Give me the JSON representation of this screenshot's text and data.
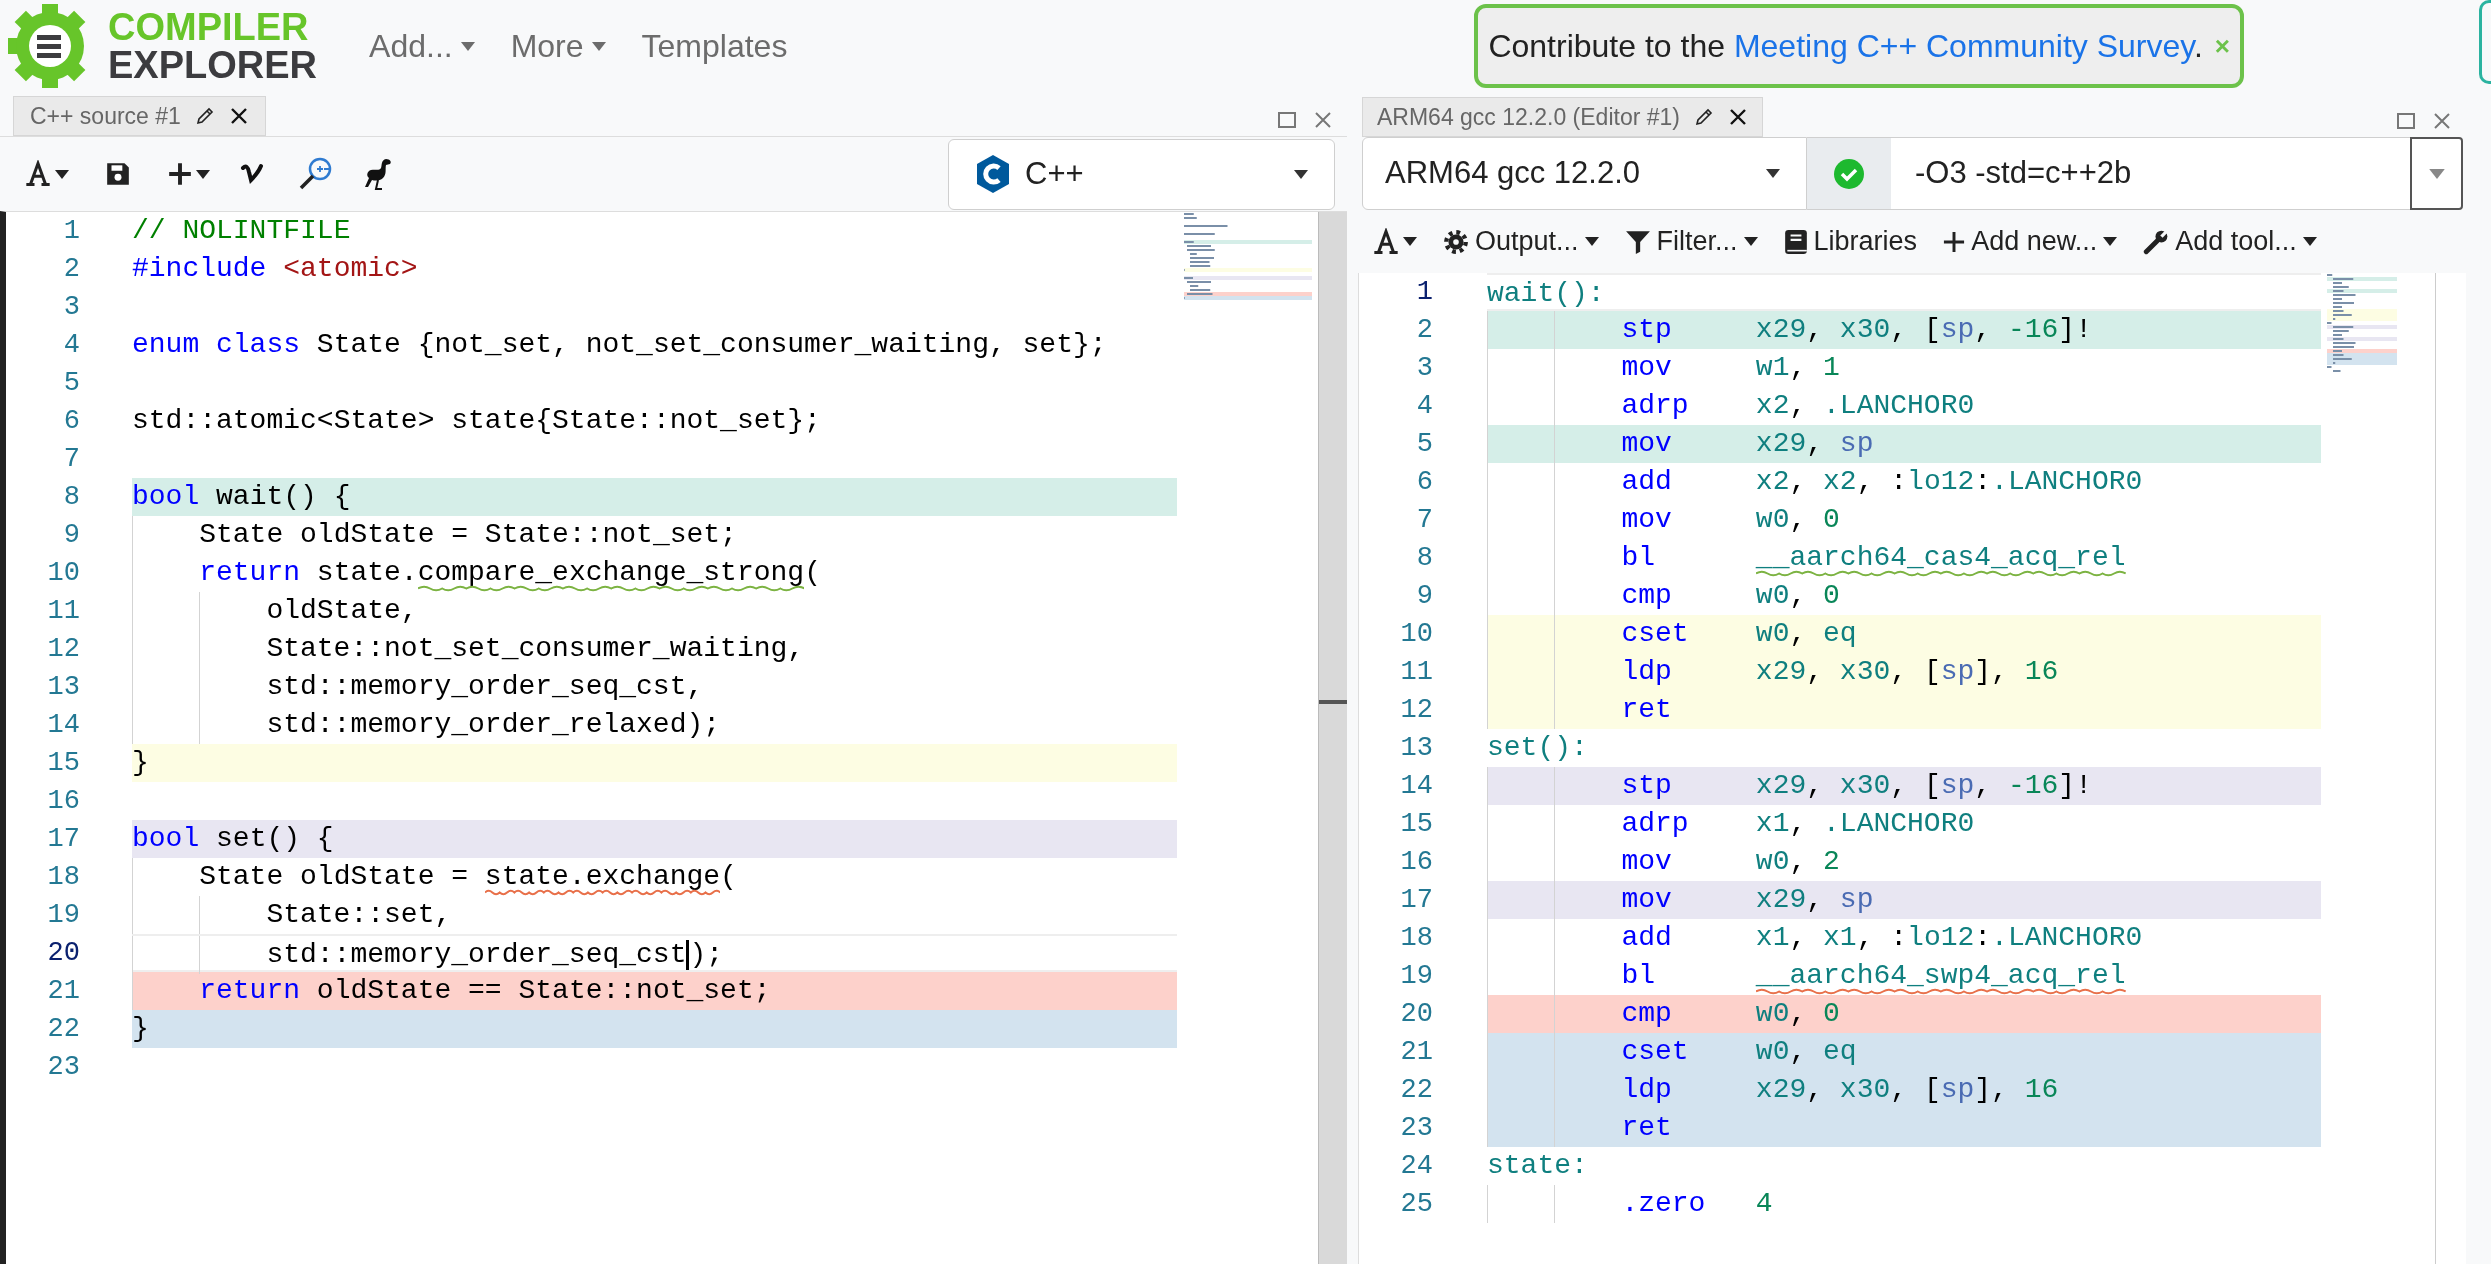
{
  "header": {
    "logo": {
      "line_1": "COMPILER",
      "line_2": "EXPLORER"
    },
    "menu": [
      {
        "label": "Add...",
        "dropdown": true
      },
      {
        "label": "More",
        "dropdown": true
      },
      {
        "label": "Templates",
        "dropdown": false
      }
    ],
    "banner": {
      "text": "Contribute to the",
      "link": "Meeting C++ Community Survey",
      "text_after": ".",
      "close": "×"
    }
  },
  "source_pane": {
    "tab": {
      "title": "C++ source #1"
    },
    "language": "C++",
    "lines": [
      {
        "number": "1",
        "current": false,
        "tokens": [
          {
            "kind": "comment",
            "text": "// NOLINTFILE"
          }
        ]
      },
      {
        "number": "2",
        "current": false,
        "tokens": [
          {
            "kind": "keyword",
            "text": "#include"
          },
          {
            "kind": "string",
            "text": " <atomic>"
          }
        ]
      },
      {
        "number": "3",
        "current": false
      },
      {
        "number": "4",
        "current": false,
        "tokens": [
          {
            "kind": "keyword",
            "text": "enum class"
          },
          {
            "kind": "plain",
            "text": " State {not_set, not_set_consumer_waiting, set};"
          }
        ]
      },
      {
        "number": "5",
        "current": false
      },
      {
        "number": "6",
        "current": false,
        "tokens": [
          {
            "kind": "plain",
            "text": "std::atomic<State> state{State::not_set};"
          }
        ]
      },
      {
        "number": "7",
        "current": false
      },
      {
        "number": "8",
        "current": false,
        "color": "#d5eee8",
        "tokens": [
          {
            "kind": "keyword",
            "text": "bool"
          },
          {
            "kind": "plain",
            "text": " wait() {"
          }
        ]
      },
      {
        "number": "9",
        "current": false,
        "tokens": [
          {
            "kind": "plain",
            "text": "    State oldState = State::not_set;"
          }
        ]
      },
      {
        "number": "10",
        "current": false,
        "tokens": [
          {
            "kind": "keyword",
            "text": "    return"
          },
          {
            "kind": "plain",
            "text": " state."
          },
          {
            "kind": "plain",
            "text": "compare_exchange_strong",
            "color": "#7cb342"
          },
          {
            "kind": "plain",
            "text": "("
          }
        ]
      },
      {
        "number": "11",
        "current": false,
        "tokens": [
          {
            "kind": "plain",
            "text": "        oldState,"
          }
        ]
      },
      {
        "number": "12",
        "current": false,
        "tokens": [
          {
            "kind": "plain",
            "text": "        State::not_set_consumer_waiting,"
          }
        ]
      },
      {
        "number": "13",
        "current": false,
        "tokens": [
          {
            "kind": "plain",
            "text": "        std::memory_order_seq_cst,"
          }
        ]
      },
      {
        "number": "14",
        "current": false,
        "tokens": [
          {
            "kind": "plain",
            "text": "        std::memory_order_relaxed);"
          }
        ]
      },
      {
        "number": "15",
        "current": false,
        "color": "#fdfde3",
        "tokens": [
          {
            "kind": "plain",
            "text": "}"
          }
        ]
      },
      {
        "number": "16",
        "current": false
      },
      {
        "number": "17",
        "current": false,
        "color": "#e8e6f2",
        "tokens": [
          {
            "kind": "keyword",
            "text": "bool"
          },
          {
            "kind": "plain",
            "text": " set() {"
          }
        ]
      },
      {
        "number": "18",
        "current": false,
        "tokens": [
          {
            "kind": "plain",
            "text": "    State oldState = "
          },
          {
            "kind": "plain",
            "text": "state.exchange",
            "color": "#e8704a"
          },
          {
            "kind": "plain",
            "text": "("
          }
        ]
      },
      {
        "number": "19",
        "current": false,
        "tokens": [
          {
            "kind": "plain",
            "text": "        State::set,"
          }
        ]
      },
      {
        "number": "20",
        "current": true,
        "tokens": [
          {
            "kind": "plain",
            "text": "        std::memory_order_seq_cst",
            "caret": true
          },
          {
            "kind": "plain",
            "text": ");"
          }
        ]
      },
      {
        "number": "21",
        "current": false,
        "color": "#fdd1cb",
        "tokens": [
          {
            "kind": "keyword",
            "text": "    return"
          },
          {
            "kind": "plain",
            "text": " oldState == State::not_set;"
          }
        ]
      },
      {
        "number": "22",
        "current": false,
        "color": "#d3e3ef",
        "tokens": [
          {
            "kind": "plain",
            "text": "}"
          }
        ]
      },
      {
        "number": "23",
        "current": false
      }
    ]
  },
  "compiler_pane": {
    "tab": {
      "title": "ARM64 gcc 12.2.0 (Editor #1)"
    },
    "compiler": "ARM64 gcc 12.2.0",
    "compile_ok": true,
    "options": "-O3 -std=c++2b",
    "toolbar": [
      {
        "label": "Output...",
        "dropdown": true
      },
      {
        "label": "Filter...",
        "dropdown": true
      },
      {
        "label": "Libraries",
        "dropdown": false
      },
      {
        "label": "Add new...",
        "dropdown": true
      },
      {
        "label": "Add tool...",
        "dropdown": true
      }
    ],
    "lines": [
      {
        "number": "1",
        "current": true,
        "kind": "label",
        "text": "wait():"
      },
      {
        "number": "2",
        "current": false,
        "kind": "instr",
        "color": "#d5eee8",
        "mnemonic": "stp",
        "operands": [
          {
            "kind": "reg",
            "text": "x29"
          },
          {
            "kind": "punct",
            "text": ", "
          },
          {
            "kind": "reg",
            "text": "x30"
          },
          {
            "kind": "punct",
            "text": ", ["
          },
          {
            "kind": "sp",
            "text": "sp"
          },
          {
            "kind": "punct",
            "text": ", "
          },
          {
            "kind": "num",
            "text": "-16"
          },
          {
            "kind": "punct",
            "text": "]!"
          }
        ]
      },
      {
        "number": "3",
        "current": false,
        "kind": "instr",
        "mnemonic": "mov",
        "operands": [
          {
            "kind": "reg",
            "text": "w1"
          },
          {
            "kind": "punct",
            "text": ", "
          },
          {
            "kind": "num",
            "text": "1"
          }
        ]
      },
      {
        "number": "4",
        "current": false,
        "kind": "instr",
        "mnemonic": "adrp",
        "operands": [
          {
            "kind": "reg",
            "text": "x2"
          },
          {
            "kind": "punct",
            "text": ", "
          },
          {
            "kind": "reg",
            "text": ".LANCHOR0"
          }
        ]
      },
      {
        "number": "5",
        "current": false,
        "kind": "instr",
        "color": "#d5eee8",
        "mnemonic": "mov",
        "operands": [
          {
            "kind": "reg",
            "text": "x29"
          },
          {
            "kind": "punct",
            "text": ", "
          },
          {
            "kind": "sp",
            "text": "sp"
          }
        ]
      },
      {
        "number": "6",
        "current": false,
        "kind": "instr",
        "mnemonic": "add",
        "operands": [
          {
            "kind": "reg",
            "text": "x2"
          },
          {
            "kind": "punct",
            "text": ", "
          },
          {
            "kind": "reg",
            "text": "x2"
          },
          {
            "kind": "punct",
            "text": ", :"
          },
          {
            "kind": "reg",
            "text": "lo12"
          },
          {
            "kind": "punct",
            "text": ":"
          },
          {
            "kind": "reg",
            "text": ".LANCHOR0"
          }
        ]
      },
      {
        "number": "7",
        "current": false,
        "kind": "instr",
        "mnemonic": "mov",
        "operands": [
          {
            "kind": "reg",
            "text": "w0"
          },
          {
            "kind": "punct",
            "text": ", "
          },
          {
            "kind": "num",
            "text": "0"
          }
        ]
      },
      {
        "number": "8",
        "current": false,
        "kind": "instr",
        "mnemonic": "bl",
        "operands": [
          {
            "kind": "reg",
            "text": "__aarch64_cas4_acq_rel",
            "color": "#7cb342"
          }
        ]
      },
      {
        "number": "9",
        "current": false,
        "kind": "instr",
        "mnemonic": "cmp",
        "operands": [
          {
            "kind": "reg",
            "text": "w0"
          },
          {
            "kind": "punct",
            "text": ", "
          },
          {
            "kind": "num",
            "text": "0"
          }
        ]
      },
      {
        "number": "10",
        "current": false,
        "kind": "instr",
        "color": "#fdfde3",
        "mnemonic": "cset",
        "operands": [
          {
            "kind": "reg",
            "text": "w0"
          },
          {
            "kind": "punct",
            "text": ", "
          },
          {
            "kind": "reg",
            "text": "eq"
          }
        ]
      },
      {
        "number": "11",
        "current": false,
        "kind": "instr",
        "color": "#fdfde3",
        "mnemonic": "ldp",
        "operands": [
          {
            "kind": "reg",
            "text": "x29"
          },
          {
            "kind": "punct",
            "text": ", "
          },
          {
            "kind": "reg",
            "text": "x30"
          },
          {
            "kind": "punct",
            "text": ", ["
          },
          {
            "kind": "sp",
            "text": "sp"
          },
          {
            "kind": "punct",
            "text": "], "
          },
          {
            "kind": "num",
            "text": "16"
          }
        ]
      },
      {
        "number": "12",
        "current": false,
        "kind": "instr",
        "color": "#fdfde3",
        "mnemonic": "ret"
      },
      {
        "number": "13",
        "current": false,
        "kind": "label",
        "text": "set():"
      },
      {
        "number": "14",
        "current": false,
        "kind": "instr",
        "color": "#e8e6f2",
        "mnemonic": "stp",
        "operands": [
          {
            "kind": "reg",
            "text": "x29"
          },
          {
            "kind": "punct",
            "text": ", "
          },
          {
            "kind": "reg",
            "text": "x30"
          },
          {
            "kind": "punct",
            "text": ", ["
          },
          {
            "kind": "sp",
            "text": "sp"
          },
          {
            "kind": "punct",
            "text": ", "
          },
          {
            "kind": "num",
            "text": "-16"
          },
          {
            "kind": "punct",
            "text": "]!"
          }
        ]
      },
      {
        "number": "15",
        "current": false,
        "kind": "instr",
        "mnemonic": "adrp",
        "operands": [
          {
            "kind": "reg",
            "text": "x1"
          },
          {
            "kind": "punct",
            "text": ", "
          },
          {
            "kind": "reg",
            "text": ".LANCHOR0"
          }
        ]
      },
      {
        "number": "16",
        "current": false,
        "kind": "instr",
        "mnemonic": "mov",
        "operands": [
          {
            "kind": "reg",
            "text": "w0"
          },
          {
            "kind": "punct",
            "text": ", "
          },
          {
            "kind": "num",
            "text": "2"
          }
        ]
      },
      {
        "number": "17",
        "current": false,
        "kind": "instr",
        "color": "#e8e6f2",
        "mnemonic": "mov",
        "operands": [
          {
            "kind": "reg",
            "text": "x29"
          },
          {
            "kind": "punct",
            "text": ", "
          },
          {
            "kind": "sp",
            "text": "sp"
          }
        ]
      },
      {
        "number": "18",
        "current": false,
        "kind": "instr",
        "mnemonic": "add",
        "operands": [
          {
            "kind": "reg",
            "text": "x1"
          },
          {
            "kind": "punct",
            "text": ", "
          },
          {
            "kind": "reg",
            "text": "x1"
          },
          {
            "kind": "punct",
            "text": ", :"
          },
          {
            "kind": "reg",
            "text": "lo12"
          },
          {
            "kind": "punct",
            "text": ":"
          },
          {
            "kind": "reg",
            "text": ".LANCHOR0"
          }
        ]
      },
      {
        "number": "19",
        "current": false,
        "kind": "instr",
        "mnemonic": "bl",
        "operands": [
          {
            "kind": "reg",
            "text": "__aarch64_swp4_acq_rel",
            "color": "#e8704a"
          }
        ]
      },
      {
        "number": "20",
        "current": false,
        "kind": "instr",
        "color": "#fdd1cb",
        "mnemonic": "cmp",
        "operands": [
          {
            "kind": "reg",
            "text": "w0"
          },
          {
            "kind": "punct",
            "text": ", "
          },
          {
            "kind": "num",
            "text": "0"
          }
        ]
      },
      {
        "number": "21",
        "current": false,
        "kind": "instr",
        "color": "#d3e3ef",
        "mnemonic": "cset",
        "operands": [
          {
            "kind": "reg",
            "text": "w0"
          },
          {
            "kind": "punct",
            "text": ", "
          },
          {
            "kind": "reg",
            "text": "eq"
          }
        ]
      },
      {
        "number": "22",
        "current": false,
        "kind": "instr",
        "color": "#d3e3ef",
        "mnemonic": "ldp",
        "operands": [
          {
            "kind": "reg",
            "text": "x29"
          },
          {
            "kind": "punct",
            "text": ", "
          },
          {
            "kind": "reg",
            "text": "x30"
          },
          {
            "kind": "punct",
            "text": ", ["
          },
          {
            "kind": "sp",
            "text": "sp"
          },
          {
            "kind": "punct",
            "text": "], "
          },
          {
            "kind": "num",
            "text": "16"
          }
        ]
      },
      {
        "number": "23",
        "current": false,
        "kind": "instr",
        "color": "#d3e3ef",
        "mnemonic": "ret"
      },
      {
        "number": "24",
        "current": false,
        "kind": "label",
        "text": "state:"
      },
      {
        "number": "25",
        "current": false,
        "kind": "instr",
        "mnemonic": ".zero",
        "operands": [
          {
            "kind": "num",
            "text": "4"
          }
        ]
      }
    ]
  }
}
